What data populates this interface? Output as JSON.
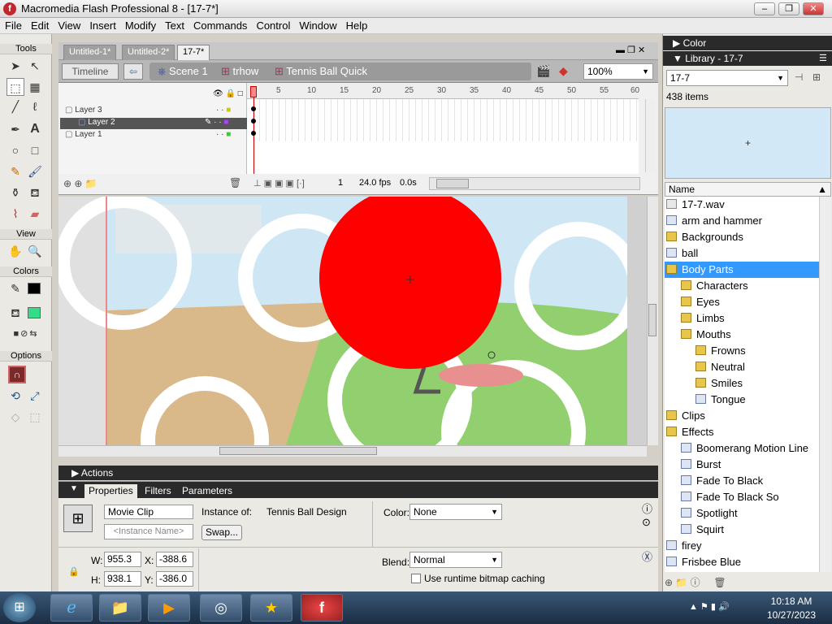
{
  "window": {
    "title": "Macromedia Flash Professional 8 - [17-7*]"
  },
  "menu": [
    "File",
    "Edit",
    "View",
    "Insert",
    "Modify",
    "Text",
    "Commands",
    "Control",
    "Window",
    "Help"
  ],
  "tools": {
    "header": "Tools",
    "view": "View",
    "colors": "Colors",
    "options": "Options"
  },
  "doc_tabs": [
    "Untitled-1*",
    "Untitled-2*",
    "17-7*"
  ],
  "edit_bar": {
    "timeline_btn": "Timeline",
    "crumbs": [
      "Scene 1",
      "trhow",
      "Tennis Ball Quick"
    ],
    "zoom": "100%"
  },
  "timeline": {
    "layers": [
      {
        "name": "Layer 3"
      },
      {
        "name": "Layer 2",
        "selected": true
      },
      {
        "name": "Layer 1"
      }
    ],
    "ruler": [
      "1",
      "5",
      "10",
      "15",
      "20",
      "25",
      "30",
      "35",
      "40",
      "45",
      "50",
      "55",
      "60"
    ],
    "status": {
      "frame": "1",
      "fps": "24.0 fps",
      "time": "0.0s"
    }
  },
  "panels": {
    "actions": "Actions",
    "tabs": [
      "Properties",
      "Filters",
      "Parameters"
    ]
  },
  "props": {
    "type": "Movie Clip",
    "instance_placeholder": "<Instance Name>",
    "instance_of_label": "Instance of:",
    "instance_of": "Tennis Ball Design",
    "swap": "Swap...",
    "color_label": "Color:",
    "color": "None",
    "blend_label": "Blend:",
    "blend": "Normal",
    "cache": "Use runtime bitmap caching",
    "w_label": "W:",
    "w": "955.3",
    "h_label": "H:",
    "h": "938.1",
    "x_label": "X:",
    "x": "-388.6",
    "y_label": "Y:",
    "y": "-386.0"
  },
  "right": {
    "color_title": "Color",
    "library_title": "Library - 17-7",
    "dropdown": "17-7",
    "count": "438 items",
    "name_header": "Name",
    "items": [
      {
        "label": "17-7.wav",
        "kind": "snd",
        "indent": 0
      },
      {
        "label": "arm and hammer",
        "kind": "sym",
        "indent": 0
      },
      {
        "label": "Backgrounds",
        "kind": "folder",
        "indent": 0
      },
      {
        "label": "ball",
        "kind": "sym",
        "indent": 0
      },
      {
        "label": "Body Parts",
        "kind": "folder",
        "indent": 0,
        "selected": true
      },
      {
        "label": "Characters",
        "kind": "folder",
        "indent": 1
      },
      {
        "label": "Eyes",
        "kind": "folder",
        "indent": 1
      },
      {
        "label": "Limbs",
        "kind": "folder",
        "indent": 1
      },
      {
        "label": "Mouths",
        "kind": "folder",
        "indent": 1
      },
      {
        "label": "Frowns",
        "kind": "folder",
        "indent": 2
      },
      {
        "label": "Neutral",
        "kind": "folder",
        "indent": 2
      },
      {
        "label": "Smiles",
        "kind": "folder",
        "indent": 2
      },
      {
        "label": "Tongue",
        "kind": "sym",
        "indent": 2
      },
      {
        "label": "Clips",
        "kind": "folder",
        "indent": 0
      },
      {
        "label": "Effects",
        "kind": "folder",
        "indent": 0
      },
      {
        "label": "Boomerang Motion Line",
        "kind": "sym",
        "indent": 1
      },
      {
        "label": "Burst",
        "kind": "sym",
        "indent": 1
      },
      {
        "label": "Fade To Black",
        "kind": "sym",
        "indent": 1
      },
      {
        "label": "Fade To Black So",
        "kind": "sym",
        "indent": 1
      },
      {
        "label": "Spotlight",
        "kind": "sym",
        "indent": 1
      },
      {
        "label": "Squirt",
        "kind": "sym",
        "indent": 1
      },
      {
        "label": "firey",
        "kind": "sym",
        "indent": 0
      },
      {
        "label": "Frisbee Blue",
        "kind": "sym",
        "indent": 0
      }
    ]
  },
  "taskbar": {
    "time": "10:18 AM",
    "date": "10/27/2023"
  },
  "colors": {
    "ball": "#ff0000",
    "stroke": "#000000",
    "fill": "#33dd88",
    "selection": "#3399ff"
  }
}
